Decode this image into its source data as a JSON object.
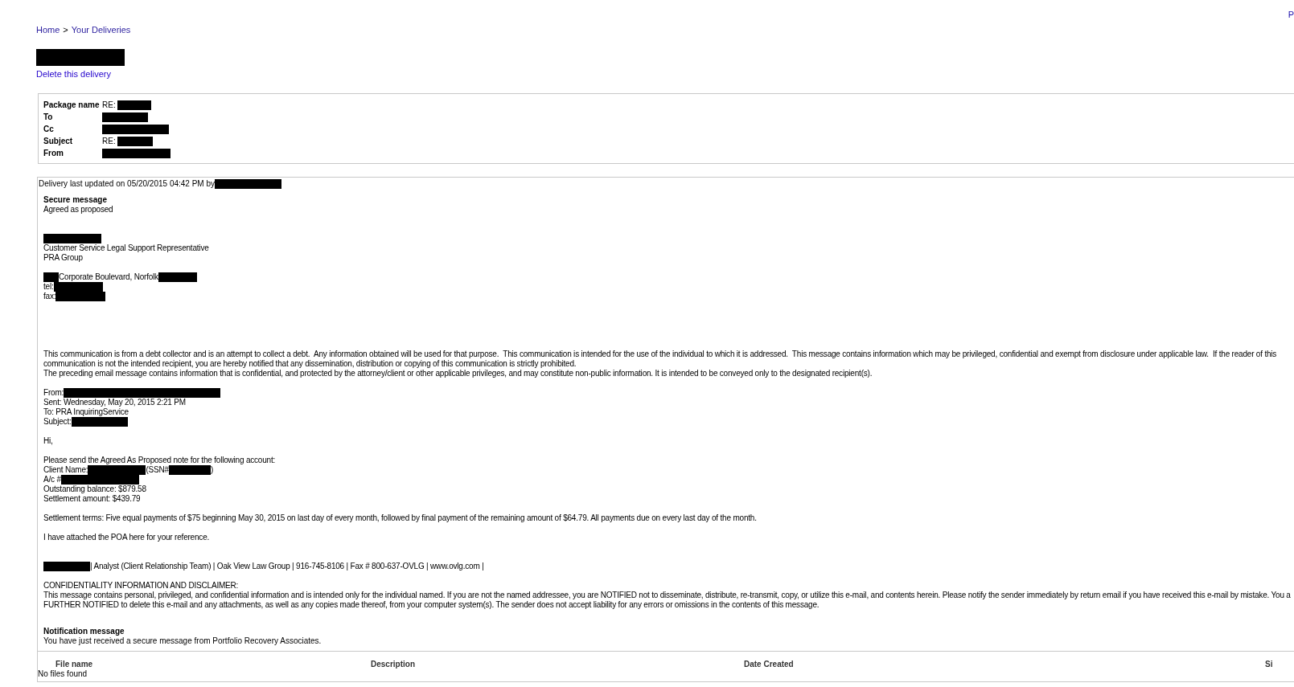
{
  "top_right_link": "P",
  "breadcrumb": {
    "items": [
      {
        "text": "Home"
      },
      {
        "text": "Your Deliveries"
      }
    ],
    "separator": ">"
  },
  "delivery_title": [
    {
      "kind": "redacted"
    }
  ],
  "delete_link": "Delete this delivery",
  "package": [
    {
      "label": "Package name",
      "value": [
        {
          "kind": "text",
          "text": "RE:"
        },
        {
          "kind": "redacted"
        }
      ]
    },
    {
      "label": "To",
      "value": [
        {
          "kind": "redacted"
        }
      ]
    },
    {
      "label": "Cc",
      "value": [
        {
          "kind": "redacted"
        }
      ]
    },
    {
      "label": "Subject",
      "value": [
        {
          "kind": "text",
          "text": "RE:"
        },
        {
          "kind": "redacted"
        }
      ]
    },
    {
      "label": "From",
      "value": [
        {
          "kind": "redacted"
        }
      ]
    }
  ],
  "delivery": {
    "updated": [
      {
        "kind": "text",
        "text": "Delivery last updated on 05/20/2015 04:42 PM by"
      },
      {
        "kind": "redacted"
      }
    ],
    "secure_message": {
      "heading": "Secure message",
      "lines": [
        {
          "kind": "line",
          "segments": [
            {
              "kind": "text",
              "text": "Agreed as proposed"
            }
          ]
        },
        {
          "kind": "blank"
        },
        {
          "kind": "blank"
        },
        {
          "kind": "line",
          "segments": [
            {
              "kind": "redacted"
            }
          ]
        },
        {
          "kind": "line",
          "segments": [
            {
              "kind": "text",
              "text": "Customer Service Legal Support Representative"
            }
          ]
        },
        {
          "kind": "line",
          "segments": [
            {
              "kind": "text",
              "text": "PRA Group"
            }
          ]
        },
        {
          "kind": "blank"
        },
        {
          "kind": "line",
          "segments": [
            {
              "kind": "redacted"
            },
            {
              "kind": "text",
              "text": "Corporate Boulevard, Norfolk"
            },
            {
              "kind": "redacted"
            }
          ]
        },
        {
          "kind": "line",
          "segments": [
            {
              "kind": "text",
              "text": "tel:"
            },
            {
              "kind": "redacted"
            }
          ]
        },
        {
          "kind": "line",
          "segments": [
            {
              "kind": "text",
              "text": "fax:"
            },
            {
              "kind": "redacted"
            }
          ]
        },
        {
          "kind": "blank"
        },
        {
          "kind": "blank"
        },
        {
          "kind": "blank"
        },
        {
          "kind": "blank"
        },
        {
          "kind": "blank"
        },
        {
          "kind": "line",
          "segments": [
            {
              "kind": "text",
              "text": "This communication is from a debt collector and is an attempt to collect a debt.  Any information obtained will be used for that purpose.  This communication is intended for the use of the individual to which it is addressed.  This message contains information which may be privileged, confidential and exempt from disclosure under applicable law.  If the reader of this"
            }
          ]
        },
        {
          "kind": "line",
          "segments": [
            {
              "kind": "text",
              "text": "communication is not the intended recipient, you are hereby notified that any dissemination, distribution or copying of this communication is strictly prohibited."
            }
          ]
        },
        {
          "kind": "line",
          "segments": [
            {
              "kind": "text",
              "text": "The preceding email message contains information that is confidential, and protected by the attorney/client or other applicable privileges, and may constitute non-public information. It is intended to be conveyed only to the designated recipient(s)."
            }
          ]
        },
        {
          "kind": "blank"
        },
        {
          "kind": "line",
          "segments": [
            {
              "kind": "text",
              "text": "From:"
            },
            {
              "kind": "redacted"
            }
          ]
        },
        {
          "kind": "line",
          "segments": [
            {
              "kind": "text",
              "text": "Sent: Wednesday, May 20, 2015 2:21 PM"
            }
          ]
        },
        {
          "kind": "line",
          "segments": [
            {
              "kind": "text",
              "text": "To: PRA InquiringService"
            }
          ]
        },
        {
          "kind": "line",
          "segments": [
            {
              "kind": "text",
              "text": "Subject:"
            },
            {
              "kind": "redacted"
            }
          ]
        },
        {
          "kind": "blank"
        },
        {
          "kind": "line",
          "segments": [
            {
              "kind": "text",
              "text": "Hi,"
            }
          ]
        },
        {
          "kind": "blank"
        },
        {
          "kind": "line",
          "segments": [
            {
              "kind": "text",
              "text": "Please send the Agreed As Proposed note for the following account:"
            }
          ]
        },
        {
          "kind": "line",
          "segments": [
            {
              "kind": "text",
              "text": "Client Name:"
            },
            {
              "kind": "redacted"
            },
            {
              "kind": "text",
              "text": "(SSN#"
            },
            {
              "kind": "redacted"
            },
            {
              "kind": "text",
              "text": ")"
            }
          ]
        },
        {
          "kind": "line",
          "segments": [
            {
              "kind": "text",
              "text": "A/c #"
            },
            {
              "kind": "redacted"
            }
          ]
        },
        {
          "kind": "line",
          "segments": [
            {
              "kind": "text",
              "text": "Outstanding balance: $879.58"
            }
          ]
        },
        {
          "kind": "line",
          "segments": [
            {
              "kind": "text",
              "text": "Settlement amount: $439.79"
            }
          ]
        },
        {
          "kind": "blank"
        },
        {
          "kind": "line",
          "segments": [
            {
              "kind": "text",
              "text": "Settlement terms: Five equal payments of $75 beginning May 30, 2015 on last day of every month, followed by final payment of the remaining amount of $64.79. All payments due on every last day of the month."
            }
          ]
        },
        {
          "kind": "blank"
        },
        {
          "kind": "line",
          "segments": [
            {
              "kind": "text",
              "text": "I have attached the POA here for your reference."
            }
          ]
        },
        {
          "kind": "blank"
        },
        {
          "kind": "blank"
        },
        {
          "kind": "line",
          "segments": [
            {
              "kind": "redacted"
            },
            {
              "kind": "text",
              "text": "| Analyst (Client Relationship Team) | Oak View Law Group | 916-745-8106 | Fax # 800-637-OVLG | www.ovlg.com |"
            }
          ]
        },
        {
          "kind": "blank"
        },
        {
          "kind": "line",
          "segments": [
            {
              "kind": "text",
              "text": "CONFIDENTIALITY INFORMATION AND DISCLAIMER:"
            }
          ]
        },
        {
          "kind": "line",
          "segments": [
            {
              "kind": "text",
              "text": "This message contains personal, privileged, and confidential information and is intended only for the individual named. If you are not the named addressee, you are NOTIFIED not to disseminate, distribute, re-transmit, copy, or utilize this e-mail, and contents herein. Please notify the sender immediately by return email if you have received this e-mail by mistake. You a"
            }
          ]
        },
        {
          "kind": "line",
          "segments": [
            {
              "kind": "text",
              "text": "FURTHER NOTIFIED to delete this e-mail and any attachments, as well as any copies made thereof, from your computer system(s). The sender does not accept liability for any errors or omissions in the contents of this message."
            }
          ]
        }
      ]
    },
    "notification": {
      "heading": "Notification message",
      "text": "You have just received a secure message from Portfolio Recovery Associates."
    }
  },
  "files": {
    "columns": [
      "File name",
      "Description",
      "Date Created",
      "Si"
    ],
    "empty": "No files found"
  }
}
